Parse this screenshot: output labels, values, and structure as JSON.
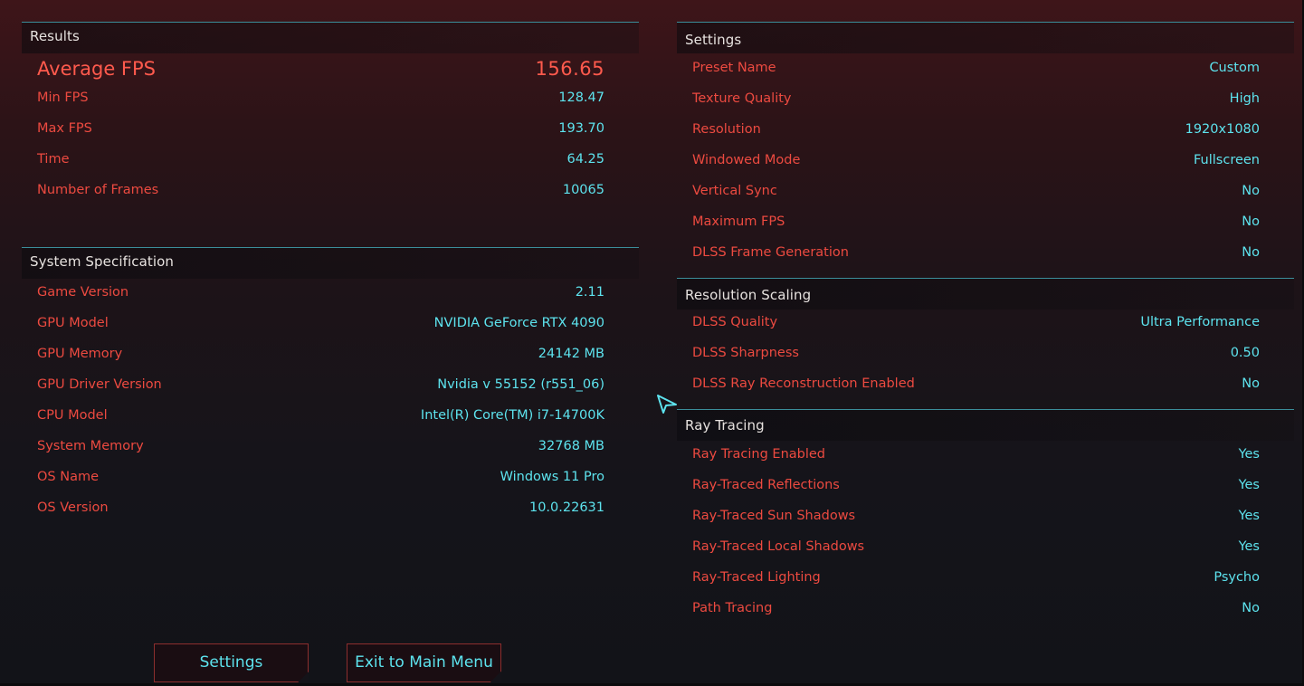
{
  "results": {
    "title": "Results",
    "average_fps": {
      "label": "Average FPS",
      "value": "156.65"
    },
    "rows": [
      {
        "label": "Min FPS",
        "value": "128.47"
      },
      {
        "label": "Max FPS",
        "value": "193.70"
      },
      {
        "label": "Time",
        "value": "64.25"
      },
      {
        "label": "Number of Frames",
        "value": "10065"
      }
    ]
  },
  "system": {
    "title": "System Specification",
    "rows": [
      {
        "label": "Game Version",
        "value": "2.11"
      },
      {
        "label": "GPU Model",
        "value": "NVIDIA GeForce RTX 4090"
      },
      {
        "label": "GPU Memory",
        "value": "24142 MB"
      },
      {
        "label": "GPU Driver Version",
        "value": "Nvidia v 55152 (r551_06)"
      },
      {
        "label": "CPU Model",
        "value": "Intel(R) Core(TM) i7-14700K"
      },
      {
        "label": "System Memory",
        "value": "32768 MB"
      },
      {
        "label": "OS Name",
        "value": "Windows 11 Pro"
      },
      {
        "label": "OS Version",
        "value": "10.0.22631"
      }
    ]
  },
  "settings": {
    "title": "Settings",
    "rows": [
      {
        "label": "Preset Name",
        "value": "Custom"
      },
      {
        "label": "Texture Quality",
        "value": "High"
      },
      {
        "label": "Resolution",
        "value": "1920x1080"
      },
      {
        "label": "Windowed Mode",
        "value": "Fullscreen"
      },
      {
        "label": "Vertical Sync",
        "value": "No"
      },
      {
        "label": "Maximum FPS",
        "value": "No"
      },
      {
        "label": "DLSS Frame Generation",
        "value": "No"
      }
    ]
  },
  "resolution_scaling": {
    "title": "Resolution Scaling",
    "rows": [
      {
        "label": "DLSS Quality",
        "value": "Ultra Performance"
      },
      {
        "label": "DLSS Sharpness",
        "value": "0.50"
      },
      {
        "label": "DLSS Ray Reconstruction Enabled",
        "value": "No"
      }
    ]
  },
  "ray_tracing": {
    "title": "Ray Tracing",
    "rows": [
      {
        "label": "Ray Tracing Enabled",
        "value": "Yes"
      },
      {
        "label": "Ray-Traced Reflections",
        "value": "Yes"
      },
      {
        "label": "Ray-Traced Sun Shadows",
        "value": "Yes"
      },
      {
        "label": "Ray-Traced Local Shadows",
        "value": "Yes"
      },
      {
        "label": "Ray-Traced Lighting",
        "value": "Psycho"
      },
      {
        "label": "Path Tracing",
        "value": "No"
      }
    ]
  },
  "buttons": {
    "settings": "Settings",
    "exit": "Exit to Main Menu"
  },
  "icons": {
    "cursor": "pointer-cursor-icon"
  },
  "colors": {
    "label_red": "#ec4a40",
    "value_cyan": "#5de3ee",
    "header_line": "#3b8e9a"
  }
}
